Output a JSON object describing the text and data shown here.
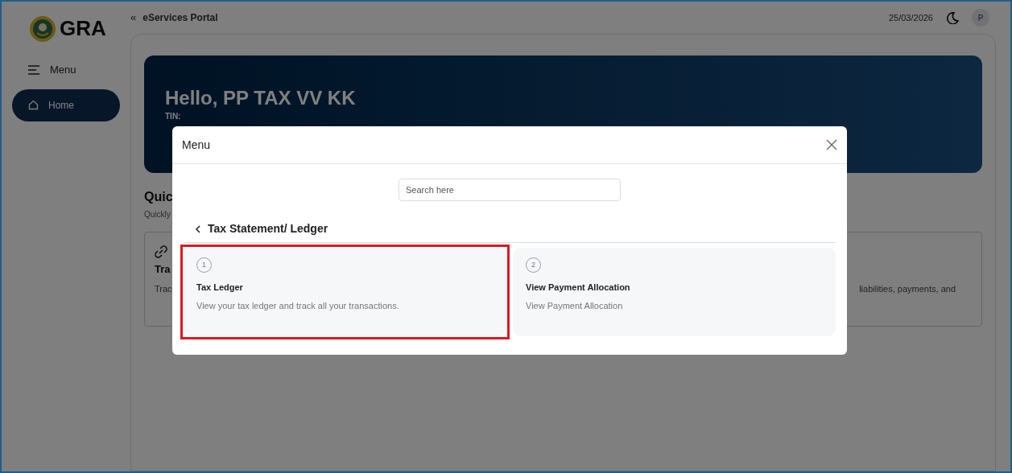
{
  "header": {
    "logo_text": "GRA",
    "collapse_icon": "«",
    "portal_title": "eServices Portal",
    "date": "25/03/2026",
    "avatar_initial": "P"
  },
  "sidebar": {
    "menu_label": "Menu",
    "items": [
      {
        "label": "Home",
        "selected": true
      }
    ]
  },
  "banner": {
    "greeting": "Hello, PP TAX VV KK",
    "tin_label": "TIN:"
  },
  "quick": {
    "title": "Quic",
    "subtitle": "Quickly",
    "card": {
      "title": "Tra",
      "text": "Trac",
      "text_right": "liabilities, payments, and"
    }
  },
  "modal": {
    "title": "Menu",
    "search": {
      "placeholder": "Search here"
    },
    "section_title": "Tax Statement/ Ledger",
    "items": [
      {
        "number": "1",
        "title": "Tax Ledger",
        "description": "View your tax ledger and track all your transactions.",
        "highlighted": true
      },
      {
        "number": "2",
        "title": "View Payment Allocation",
        "description": "View Payment Allocation",
        "highlighted": false
      }
    ]
  }
}
